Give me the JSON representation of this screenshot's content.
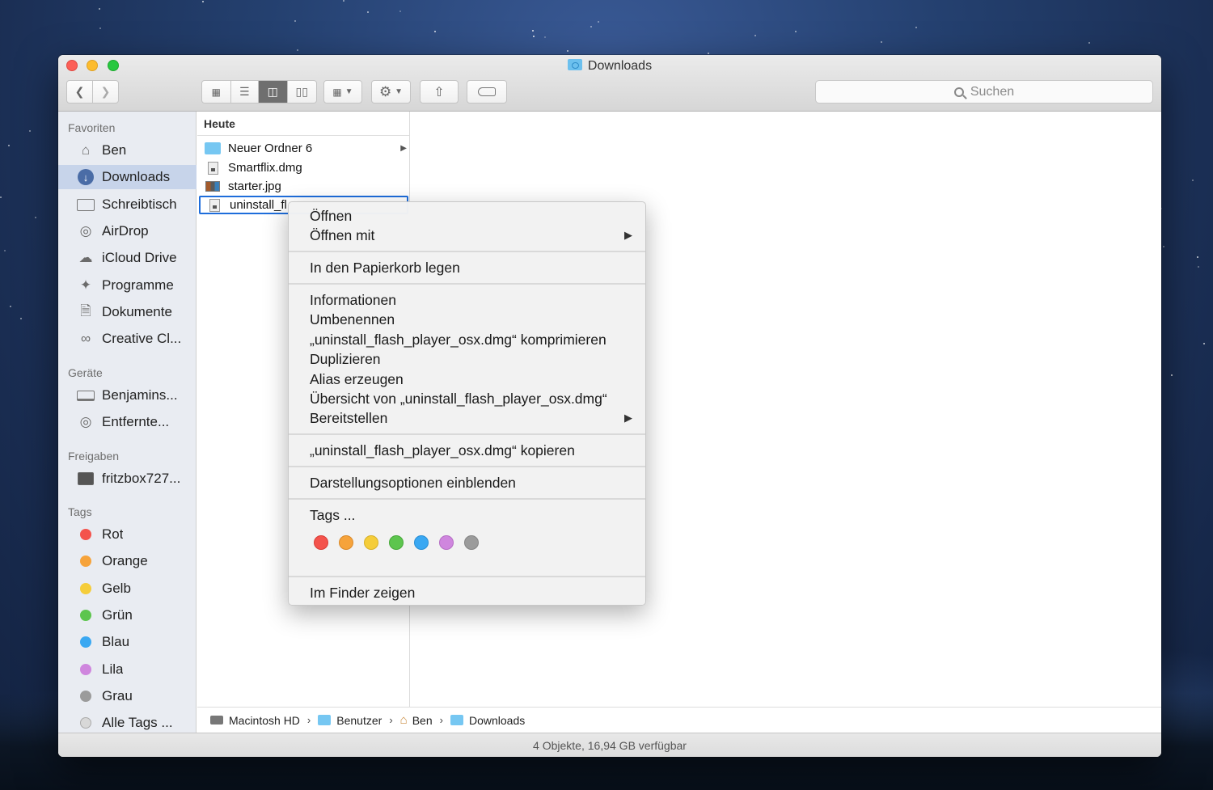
{
  "window": {
    "title": "Downloads"
  },
  "toolbar": {
    "view_icons": [
      "icon-grid-icon",
      "list-view-icon",
      "column-view-icon",
      "cover-flow-icon"
    ],
    "active_view": "column",
    "search_placeholder": "Suchen"
  },
  "sidebar": {
    "favorites_heading": "Favoriten",
    "favorites": [
      {
        "label": "Ben",
        "icon": "home-icon"
      },
      {
        "label": "Downloads",
        "icon": "downloads-icon",
        "selected": true
      },
      {
        "label": "Schreibtisch",
        "icon": "desktop-icon"
      },
      {
        "label": "AirDrop",
        "icon": "airdrop-icon"
      },
      {
        "label": "iCloud Drive",
        "icon": "cloud-icon"
      },
      {
        "label": "Programme",
        "icon": "applications-icon"
      },
      {
        "label": "Dokumente",
        "icon": "documents-icon"
      },
      {
        "label": "Creative Cl...",
        "icon": "creative-cloud-icon"
      }
    ],
    "devices_heading": "Geräte",
    "devices": [
      {
        "label": "Benjamins...",
        "icon": "laptop-icon"
      },
      {
        "label": "Entfernte...",
        "icon": "disc-icon"
      }
    ],
    "shared_heading": "Freigaben",
    "shared": [
      {
        "label": "fritzbox727...",
        "icon": "monitor-icon"
      }
    ],
    "tags_heading": "Tags",
    "tags": [
      {
        "label": "Rot",
        "color": "#f4534c"
      },
      {
        "label": "Orange",
        "color": "#f6a33b"
      },
      {
        "label": "Gelb",
        "color": "#f5cd3a"
      },
      {
        "label": "Grün",
        "color": "#5dc54e"
      },
      {
        "label": "Blau",
        "color": "#3aa8f2"
      },
      {
        "label": "Lila",
        "color": "#cf86de"
      },
      {
        "label": "Grau",
        "color": "#9b9b9b"
      },
      {
        "label": "Alle Tags ...",
        "color": "#d8d8d8"
      }
    ]
  },
  "column": {
    "heading": "Heute",
    "files": [
      {
        "name": "Neuer Ordner 6",
        "type": "folder"
      },
      {
        "name": "Smartflix.dmg",
        "type": "dmg"
      },
      {
        "name": "starter.jpg",
        "type": "jpg"
      },
      {
        "name": "uninstall_fl",
        "type": "dmg",
        "selected": true
      }
    ]
  },
  "context_menu": {
    "items": {
      "open": "Öffnen",
      "open_with": "Öffnen mit",
      "trash": "In den Papierkorb legen",
      "info": "Informationen",
      "rename": "Umbenennen",
      "compress": "„uninstall_flash_player_osx.dmg“ komprimieren",
      "duplicate": "Duplizieren",
      "alias": "Alias erzeugen",
      "quicklook": "Übersicht von „uninstall_flash_player_osx.dmg“",
      "share": "Bereitstellen",
      "copy": "„uninstall_flash_player_osx.dmg“ kopieren",
      "view_options": "Darstellungsoptionen einblenden",
      "tags": "Tags ...",
      "show_in_finder": "Im Finder zeigen"
    },
    "tag_colors": [
      "#f4534c",
      "#f6a33b",
      "#f5cd3a",
      "#5dc54e",
      "#3aa8f2",
      "#cf86de",
      "#9b9b9b"
    ]
  },
  "pathbar": {
    "segments": [
      "Macintosh HD",
      "Benutzer",
      "Ben",
      "Downloads"
    ]
  },
  "status": {
    "text": "4 Objekte, 16,94 GB verfügbar"
  }
}
